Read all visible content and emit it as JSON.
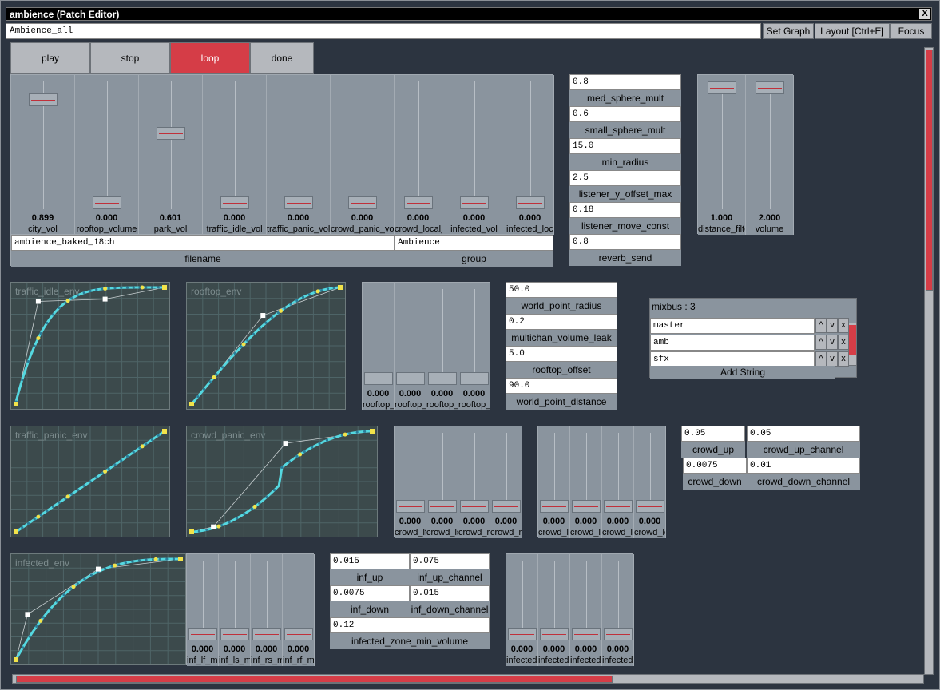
{
  "window": {
    "title": "ambience (Patch Editor)",
    "close_label": "X"
  },
  "toolbar": {
    "patch_name": "Ambience_all",
    "set_graph": "Set Graph",
    "layout": "Layout [Ctrl+E]",
    "focus": "Focus"
  },
  "transport": {
    "play": "play",
    "stop": "stop",
    "loop": "loop",
    "done": "done"
  },
  "volumes": [
    {
      "value": "0.899",
      "label": "city_vol",
      "level": 0.899
    },
    {
      "value": "0.000",
      "label": "rooftop_volume",
      "level": 0
    },
    {
      "value": "0.601",
      "label": "park_vol",
      "level": 0.601
    },
    {
      "value": "0.000",
      "label": "traffic_idle_vol",
      "level": 0
    },
    {
      "value": "0.000",
      "label": "traffic_panic_vol",
      "level": 0
    },
    {
      "value": "0.000",
      "label": "crowd_panic_vol",
      "level": 0
    },
    {
      "value": "0.000",
      "label": "crowd_local_vol",
      "level": 0
    },
    {
      "value": "0.000",
      "label": "infected_vol",
      "level": 0
    },
    {
      "value": "0.000",
      "label": "infected_local_vol",
      "level": 0
    }
  ],
  "filename": {
    "value": "ambience_baked_18ch",
    "label": "filename"
  },
  "group": {
    "value": "Ambience",
    "label": "group"
  },
  "params1": [
    {
      "value": "0.8",
      "label": "med_sphere_mult"
    },
    {
      "value": "0.6",
      "label": "small_sphere_mult"
    },
    {
      "value": "15.0",
      "label": "min_radius"
    },
    {
      "value": "2.5",
      "label": "listener_y_offset_max"
    },
    {
      "value": "0.18",
      "label": "listener_move_const"
    },
    {
      "value": "0.8",
      "label": "reverb_send"
    }
  ],
  "dist_sliders": [
    {
      "value": "1.000",
      "label": "distance_filter",
      "level": 1
    },
    {
      "value": "2.000",
      "label": "volume",
      "level": 1
    }
  ],
  "envelopes": {
    "traffic_idle": "traffic_idle_env",
    "rooftop": "rooftop_env",
    "traffic_panic": "traffic_panic_env",
    "crowd_panic": "crowd_panic_env",
    "infected": "infected_env"
  },
  "rooftop_sliders": [
    {
      "value": "0.000",
      "label": "rooftop_lf_mult",
      "level": 0
    },
    {
      "value": "0.000",
      "label": "rooftop_ls_mult",
      "level": 0
    },
    {
      "value": "0.000",
      "label": "rooftop_rs_mult",
      "level": 0
    },
    {
      "value": "0.000",
      "label": "rooftop_rf_mult",
      "level": 0
    }
  ],
  "params2": [
    {
      "value": "50.0",
      "label": "world_point_radius"
    },
    {
      "value": "0.2",
      "label": "multichan_volume_leak"
    },
    {
      "value": "5.0",
      "label": "rooftop_offset"
    },
    {
      "value": "90.0",
      "label": "world_point_distance"
    }
  ],
  "mixbus": {
    "title": "mixbus : 3",
    "items": [
      "master",
      "amb",
      "sfx"
    ],
    "add_label": "Add String",
    "up": "^",
    "down": "v",
    "remove": "x"
  },
  "crowd_sliders": [
    {
      "value": "0.000",
      "label": "crowd_lf_mult",
      "level": 0
    },
    {
      "value": "0.000",
      "label": "crowd_ls_mult",
      "level": 0
    },
    {
      "value": "0.000",
      "label": "crowd_rs_mult",
      "level": 0
    },
    {
      "value": "0.000",
      "label": "crowd_rf_mult",
      "level": 0
    }
  ],
  "crowd_local_sliders": [
    {
      "value": "0.000",
      "label": "crowd_local_lf",
      "level": 0
    },
    {
      "value": "0.000",
      "label": "crowd_local_ls",
      "level": 0
    },
    {
      "value": "0.000",
      "label": "crowd_local_rs",
      "level": 0
    },
    {
      "value": "0.000",
      "label": "crowd_local_rf",
      "level": 0
    }
  ],
  "crowd_params": [
    {
      "value": "0.05",
      "label": "crowd_up"
    },
    {
      "value": "0.05",
      "label": "crowd_up_channel"
    },
    {
      "value": "0.0075",
      "label": "crowd_down"
    },
    {
      "value": "0.01",
      "label": "crowd_down_channel"
    }
  ],
  "inf_sliders": [
    {
      "value": "0.000",
      "label": "inf_lf_mult",
      "level": 0
    },
    {
      "value": "0.000",
      "label": "inf_ls_mult",
      "level": 0
    },
    {
      "value": "0.000",
      "label": "inf_rs_mult",
      "level": 0
    },
    {
      "value": "0.000",
      "label": "inf_rf_mult",
      "level": 0
    }
  ],
  "inf_params": [
    {
      "value": "0.015",
      "label": "inf_up"
    },
    {
      "value": "0.075",
      "label": "inf_up_channel"
    },
    {
      "value": "0.0075",
      "label": "inf_down"
    },
    {
      "value": "0.015",
      "label": "inf_down_channel"
    },
    {
      "value": "0.12",
      "label": "infected_zone_min_volume"
    }
  ],
  "inf_local_sliders": [
    {
      "value": "0.000",
      "label": "infected_local_lf",
      "level": 0
    },
    {
      "value": "0.000",
      "label": "infected_local_ls",
      "level": 0
    },
    {
      "value": "0.000",
      "label": "infected_local_rs",
      "level": 0
    },
    {
      "value": "0.000",
      "label": "infected_local_rf",
      "level": 0
    }
  ],
  "colors": {
    "accent": "#d53d47",
    "panel": "#8a949e",
    "curve": "#55d8e0",
    "point": "#f2e34a"
  }
}
